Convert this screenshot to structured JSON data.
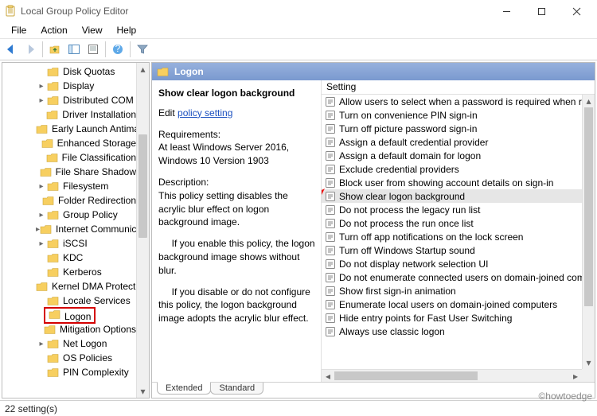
{
  "window": {
    "title": "Local Group Policy Editor"
  },
  "menu": {
    "items": [
      "File",
      "Action",
      "View",
      "Help"
    ]
  },
  "toolbar": {
    "buttons": [
      "back",
      "forward",
      "up",
      "tree-toggle",
      "properties",
      "help",
      "filter"
    ]
  },
  "tree": {
    "items": [
      {
        "label": "Disk Quotas",
        "expander": ""
      },
      {
        "label": "Display",
        "expander": ">"
      },
      {
        "label": "Distributed COM",
        "expander": ">"
      },
      {
        "label": "Driver Installation",
        "expander": ""
      },
      {
        "label": "Early Launch Antimalware",
        "expander": ""
      },
      {
        "label": "Enhanced Storage",
        "expander": ""
      },
      {
        "label": "File Classification",
        "expander": ""
      },
      {
        "label": "File Share Shadow",
        "expander": ""
      },
      {
        "label": "Filesystem",
        "expander": ">"
      },
      {
        "label": "Folder Redirection",
        "expander": ""
      },
      {
        "label": "Group Policy",
        "expander": ">"
      },
      {
        "label": "Internet Communication",
        "expander": ">"
      },
      {
        "label": "iSCSI",
        "expander": ">"
      },
      {
        "label": "KDC",
        "expander": ""
      },
      {
        "label": "Kerberos",
        "expander": ""
      },
      {
        "label": "Kernel DMA Protection",
        "expander": ""
      },
      {
        "label": "Locale Services",
        "expander": ""
      },
      {
        "label": "Logon",
        "expander": "",
        "highlighted": true
      },
      {
        "label": "Mitigation Options",
        "expander": ""
      },
      {
        "label": "Net Logon",
        "expander": ">"
      },
      {
        "label": "OS Policies",
        "expander": ""
      },
      {
        "label": "PIN Complexity",
        "expander": ""
      }
    ]
  },
  "right": {
    "header": "Logon",
    "desc": {
      "title": "Show clear logon background",
      "edit_prefix": "Edit ",
      "edit_link": "policy setting ",
      "req_label": "Requirements:",
      "req_text": "At least Windows Server 2016, Windows 10 Version 1903",
      "desc_label": "Description:",
      "desc_text": "This policy setting disables the acrylic blur effect on logon background image.",
      "para_enable": "     If you enable this policy, the logon background image shows without blur.",
      "para_disable": "     If you disable or do not configure this policy, the logon background image adopts the acrylic blur effect."
    },
    "column_header": "Setting",
    "settings": [
      "Allow users to select when a password is required when resuming",
      "Turn on convenience PIN sign-in",
      "Turn off picture password sign-in",
      "Assign a default credential provider",
      "Assign a default domain for logon",
      "Exclude credential providers",
      "Block user from showing account details on sign-in",
      "Show clear logon background",
      "Do not process the legacy run list",
      "Do not process the run once list",
      "Turn off app notifications on the lock screen",
      "Turn off Windows Startup sound",
      "Do not display network selection UI",
      "Do not enumerate connected users on domain-joined computers",
      "Show first sign-in animation",
      "Enumerate local users on domain-joined computers",
      "Hide entry points for Fast User Switching",
      "Always use classic logon"
    ],
    "selected_index": 7,
    "tabs": {
      "extended": "Extended",
      "standard": "Standard"
    }
  },
  "status": {
    "text": "22 setting(s)"
  },
  "watermark": "©howtoedge"
}
